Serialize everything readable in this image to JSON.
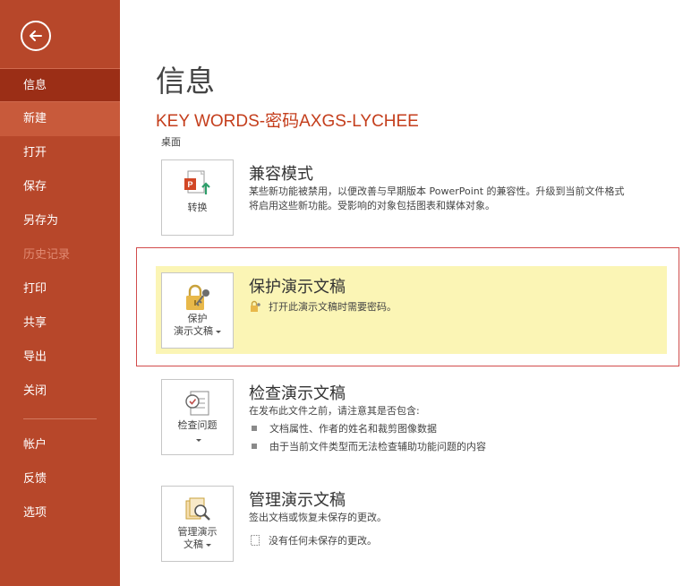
{
  "sidebar": {
    "items": [
      {
        "label": "信息"
      },
      {
        "label": "新建"
      },
      {
        "label": "打开"
      },
      {
        "label": "保存"
      },
      {
        "label": "另存为"
      },
      {
        "label": "历史记录"
      },
      {
        "label": "打印"
      },
      {
        "label": "共享"
      },
      {
        "label": "导出"
      },
      {
        "label": "关闭"
      },
      {
        "label": "帐户"
      },
      {
        "label": "反馈"
      },
      {
        "label": "选项"
      }
    ]
  },
  "main": {
    "page_title": "信息",
    "doc_title": "KEY WORDS-密码AXGS-LYCHEE",
    "doc_location": "桌面",
    "compat": {
      "button_label": "转换",
      "title": "兼容模式",
      "desc_line1": "某些新功能被禁用，以便改善与早期版本 PowerPoint 的兼容性。升级到当前文件格式",
      "desc_line2": "将启用这些新功能。受影响的对象包括图表和媒体对象。"
    },
    "protect": {
      "button_line1": "保护",
      "button_line2": "演示文稿",
      "title": "保护演示文稿",
      "desc": "打开此演示文稿时需要密码。"
    },
    "inspect": {
      "button_line1": "检查问题",
      "title": "检查演示文稿",
      "desc": "在发布此文件之前，请注意其是否包含:",
      "bullets": [
        "文档属性、作者的姓名和裁剪图像数据",
        "由于当前文件类型而无法检查辅助功能问题的内容"
      ]
    },
    "manage": {
      "button_line1": "管理演示",
      "button_line2": "文稿",
      "title": "管理演示文稿",
      "desc": "签出文档或恢复未保存的更改。",
      "note": "没有任何未保存的更改。"
    }
  },
  "colors": {
    "sidebar_bg": "#b7472a",
    "sidebar_selected": "#9b2e16",
    "doc_title": "#c43e1c",
    "protect_highlight": "#fbf5b5",
    "protect_border": "#d24c4c"
  }
}
